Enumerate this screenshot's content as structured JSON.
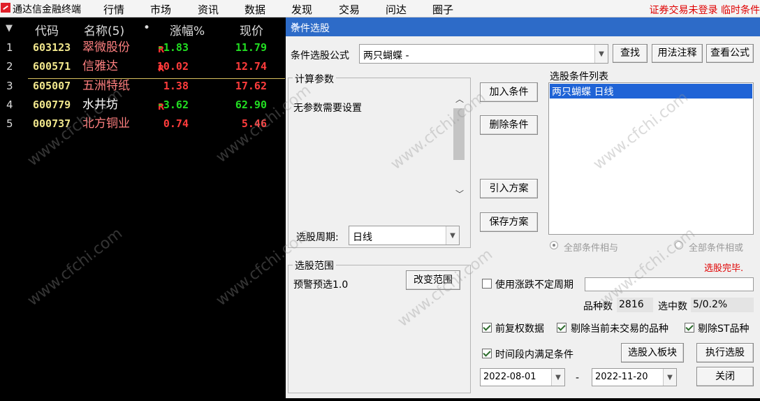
{
  "menubar": {
    "app_name": "通达信金融终端",
    "items": [
      "行情",
      "市场",
      "资讯",
      "数据",
      "发现",
      "交易",
      "问达",
      "圈子"
    ],
    "status": "证券交易未登录  临时条件"
  },
  "stocklist": {
    "headers": {
      "code": "代码",
      "name": "名称(5)",
      "dot": "•",
      "change": "涨幅%",
      "price": "现价"
    },
    "rows": [
      {
        "idx": "1",
        "code": "603123",
        "name": "翠微股份",
        "flag": "R",
        "change": "-1.83",
        "price": "11.79",
        "dir": "down",
        "name_color": "#ff8080"
      },
      {
        "idx": "2",
        "code": "600571",
        "name": "信雅达",
        "flag": "R",
        "change": "10.02",
        "price": "12.74",
        "dir": "up",
        "name_color": "#ff8080"
      },
      {
        "idx": "3",
        "code": "605007",
        "name": "五洲特纸",
        "flag": "",
        "change": "1.38",
        "price": "17.62",
        "dir": "up",
        "name_color": "#ff8080"
      },
      {
        "idx": "4",
        "code": "600779",
        "name": "水井坊",
        "flag": "R",
        "change": "-3.62",
        "price": "62.90",
        "dir": "down",
        "name_color": "#ffffff"
      },
      {
        "idx": "5",
        "code": "000737",
        "name": "北方铜业",
        "flag": "",
        "change": "0.74",
        "price": "5.46",
        "dir": "up",
        "name_color": "#ff8080"
      }
    ]
  },
  "dialog": {
    "title": "条件选股",
    "formula_label": "条件选股公式",
    "formula_value": "两只蝴蝶    -",
    "find_btn": "查找",
    "usage_btn": "用法注释",
    "view_btn": "查看公式",
    "params_group": "计算参数",
    "params_text": "无参数需要设置",
    "period_label": "选股周期:",
    "period_value": "日线",
    "scope_group": "选股范围",
    "scope_text": "预警预选1.0",
    "change_scope_btn": "改变范围",
    "add_cond_btn": "加入条件",
    "del_cond_btn": "删除条件",
    "import_btn": "引入方案",
    "save_btn": "保存方案",
    "cond_list_label": "选股条件列表",
    "cond_list_items": [
      "两只蝴蝶  日线"
    ],
    "radio_and": "全部条件相与",
    "radio_or": "全部条件相或",
    "done_text": "选股完毕.",
    "use_uncertain_period": "使用涨跌不定周期",
    "count_label": "品种数",
    "count_value": "2816",
    "selected_label": "选中数",
    "selected_value": "5/0.2%",
    "pre_adjust": "前复权数据",
    "exclude_untraded": "剔除当前未交易的品种",
    "exclude_st": "剔除ST品种",
    "time_range_check": "时间段内满足条件",
    "to_block_btn": "选股入板块",
    "execute_btn": "执行选股",
    "date_from": "2022-08-01",
    "date_sep": "-",
    "date_to": "2022-11-20",
    "close_btn": "关闭"
  },
  "watermark": "www.cfchi.com",
  "colors": {
    "title_bar": "#2d6bc8",
    "list_selection": "#1f63d6",
    "up": "#ff3c3c",
    "down": "#22dd22",
    "code": "#f0e68c"
  }
}
